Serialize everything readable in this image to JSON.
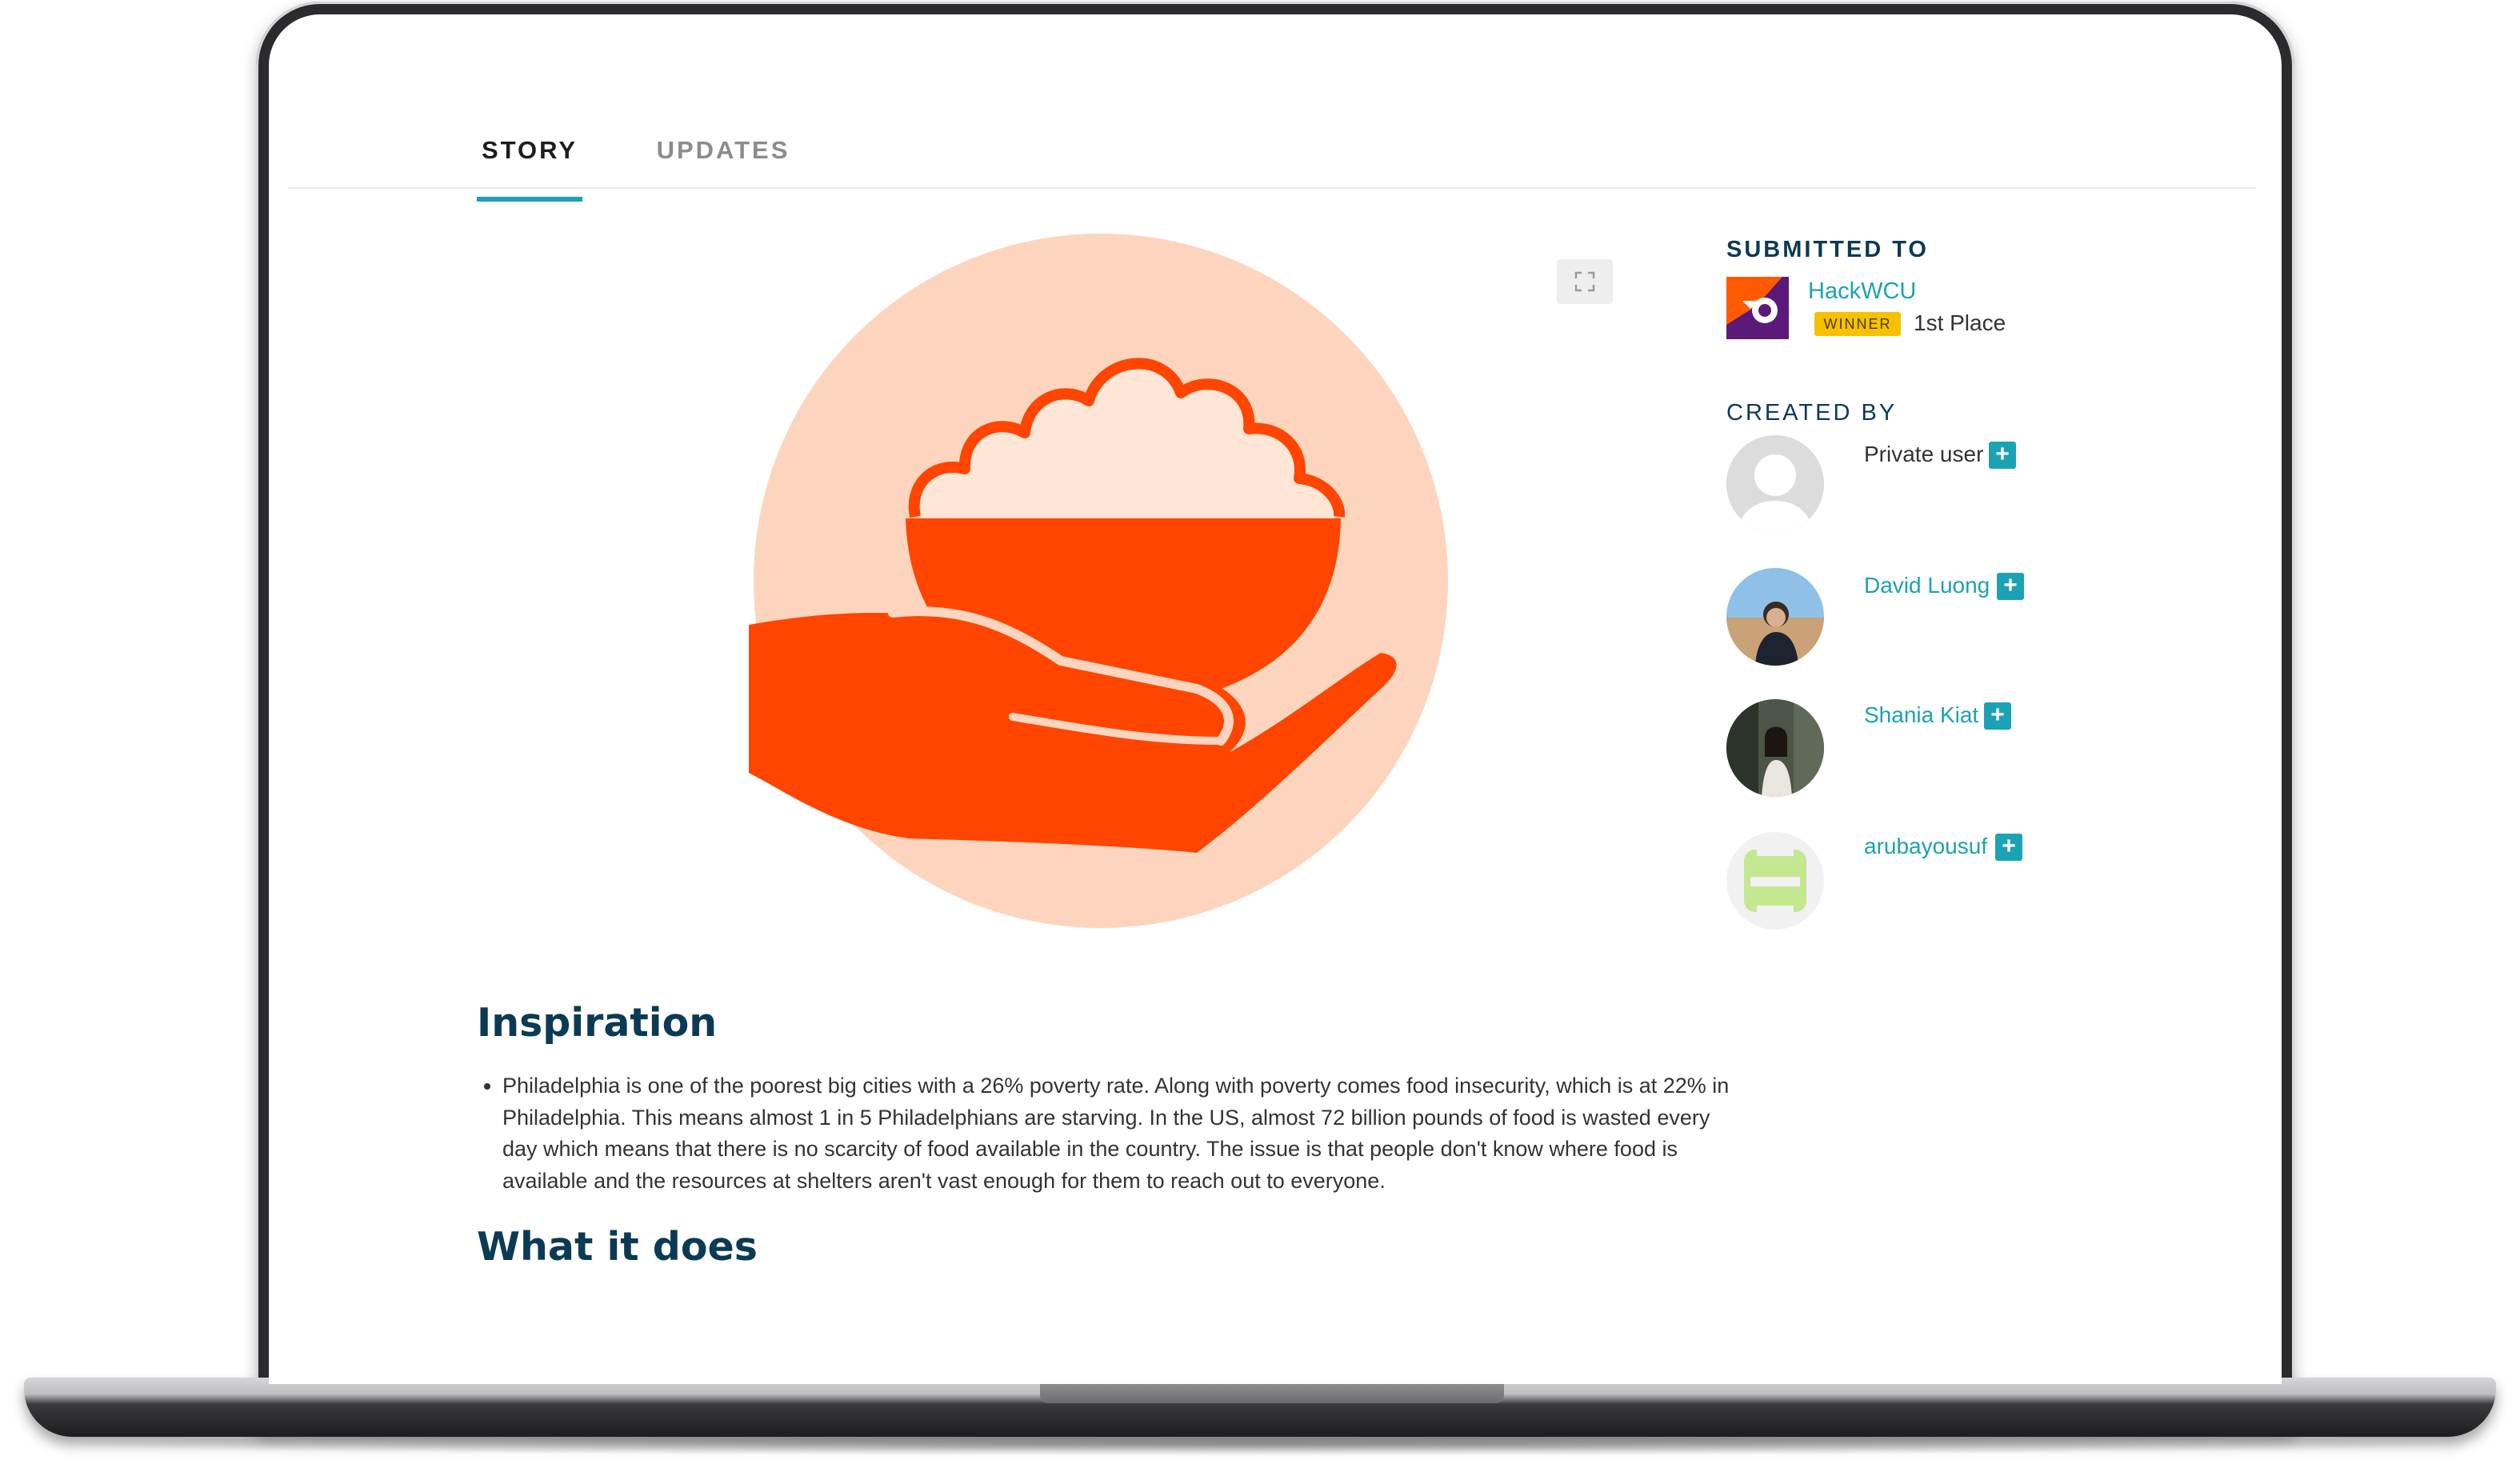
{
  "tabs": {
    "story": "STORY",
    "updates": "UPDATES"
  },
  "content": {
    "inspiration_heading": "Inspiration",
    "inspiration_items": [
      "Philadelphia is one of the poorest big cities with a 26% poverty rate. Along with poverty comes food insecurity, which is at 22% in Philadelphia. This means almost 1 in 5 Philadelphians are starving. In the US, almost 72 billion pounds of food is wasted every day which means that there is no scarcity of food available in the country. The issue is that people don't know where food is available and the resources at shelters aren't vast enough for them to reach out to everyone."
    ],
    "what_heading": "What it does"
  },
  "sidebar": {
    "submitted_heading": "SUBMITTED TO",
    "hackathon": {
      "name": "HackWCU",
      "badge": "WINNER",
      "place": "1st Place"
    },
    "created_heading": "CREATED BY",
    "members": [
      {
        "name": "Private user",
        "plus": "+"
      },
      {
        "name": "David Luong",
        "plus": "+"
      },
      {
        "name": "Shania Kiat",
        "plus": "+"
      },
      {
        "name": "arubayousuf",
        "plus": "+"
      }
    ]
  },
  "colors": {
    "accent": "#1ba2b4",
    "heading": "#0b3a55",
    "hero_circle": "#fdd5bf",
    "hero_orange": "#ff4500",
    "winner": "#f6c200"
  },
  "icons": {
    "expand": "expand-icon",
    "plus": "plus-icon"
  }
}
